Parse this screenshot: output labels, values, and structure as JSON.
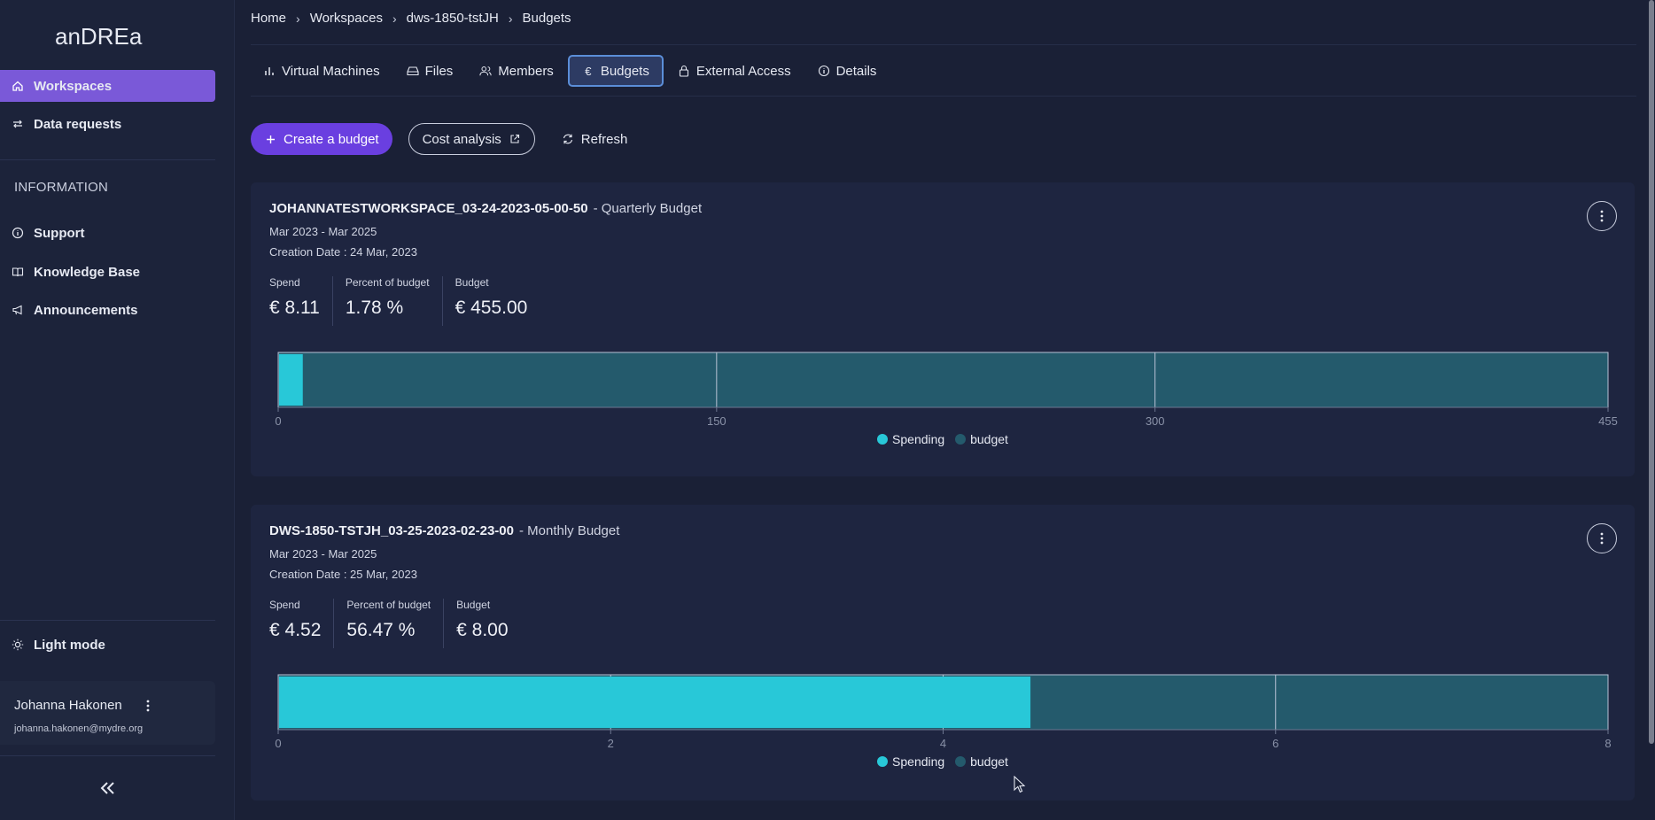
{
  "app": {
    "brand": "anDREa"
  },
  "sidebar": {
    "items": [
      {
        "label": "Workspaces",
        "icon": "home-icon",
        "active": true
      },
      {
        "label": "Data requests",
        "icon": "swap-icon",
        "active": false
      }
    ],
    "info_section": "INFORMATION",
    "info_items": [
      {
        "label": "Support",
        "icon": "info-icon"
      },
      {
        "label": "Knowledge Base",
        "icon": "book-icon"
      },
      {
        "label": "Announcements",
        "icon": "megaphone-icon"
      }
    ],
    "light_mode": "Light mode",
    "user": {
      "name": "Johanna Hakonen",
      "email": "johanna.hakonen@mydre.org"
    }
  },
  "breadcrumb": [
    "Home",
    "Workspaces",
    "dws-1850-tstJH",
    "Budgets"
  ],
  "tabs": [
    {
      "label": "Virtual Machines",
      "icon": "bar-chart-icon"
    },
    {
      "label": "Files",
      "icon": "drive-icon"
    },
    {
      "label": "Members",
      "icon": "users-icon"
    },
    {
      "label": "Budgets",
      "icon": "euro-icon",
      "active": true
    },
    {
      "label": "External Access",
      "icon": "lock-icon"
    },
    {
      "label": "Details",
      "icon": "info-icon"
    }
  ],
  "actions": {
    "create": "Create a budget",
    "cost_analysis": "Cost analysis",
    "refresh": "Refresh"
  },
  "colors": {
    "spending": "#28c8d8",
    "budget": "#245a6c",
    "accent": "#6a3fe0"
  },
  "budgets": [
    {
      "name": "JOHANNATESTWORKSPACE_03-24-2023-05-00-50",
      "type": "- Quarterly Budget",
      "dates": "Mar 2023 - Mar 2025",
      "created": "Creation Date : 24 Mar, 2023",
      "spend_label": "Spend",
      "spend": "€ 8.11",
      "percent_label": "Percent of budget",
      "percent": "1.78 %",
      "budget_label": "Budget",
      "budget": "€ 455.00"
    },
    {
      "name": "DWS-1850-TSTJH_03-25-2023-02-23-00",
      "type": "- Monthly Budget",
      "dates": "Mar 2023 - Mar 2025",
      "created": "Creation Date : 25 Mar, 2023",
      "spend_label": "Spend",
      "spend": "€ 4.52",
      "percent_label": "Percent of budget",
      "percent": "56.47 %",
      "budget_label": "Budget",
      "budget": "€ 8.00"
    }
  ],
  "chart_data": [
    {
      "type": "bar",
      "orientation": "horizontal",
      "series": [
        {
          "name": "Spending",
          "values": [
            8.11
          ]
        },
        {
          "name": "budget",
          "values": [
            455
          ]
        }
      ],
      "xlim": [
        0,
        455
      ],
      "xticks": [
        "0",
        "150",
        "300",
        "455"
      ],
      "xtick_values": [
        0,
        150,
        300,
        455
      ],
      "legend": "bottom-center"
    },
    {
      "type": "bar",
      "orientation": "horizontal",
      "series": [
        {
          "name": "Spending",
          "values": [
            4.52
          ]
        },
        {
          "name": "budget",
          "values": [
            8
          ]
        }
      ],
      "xlim": [
        0,
        8
      ],
      "xticks": [
        "0",
        "2",
        "4",
        "6",
        "8"
      ],
      "xtick_values": [
        0,
        2,
        4,
        6,
        8
      ],
      "legend": "bottom-center"
    }
  ]
}
